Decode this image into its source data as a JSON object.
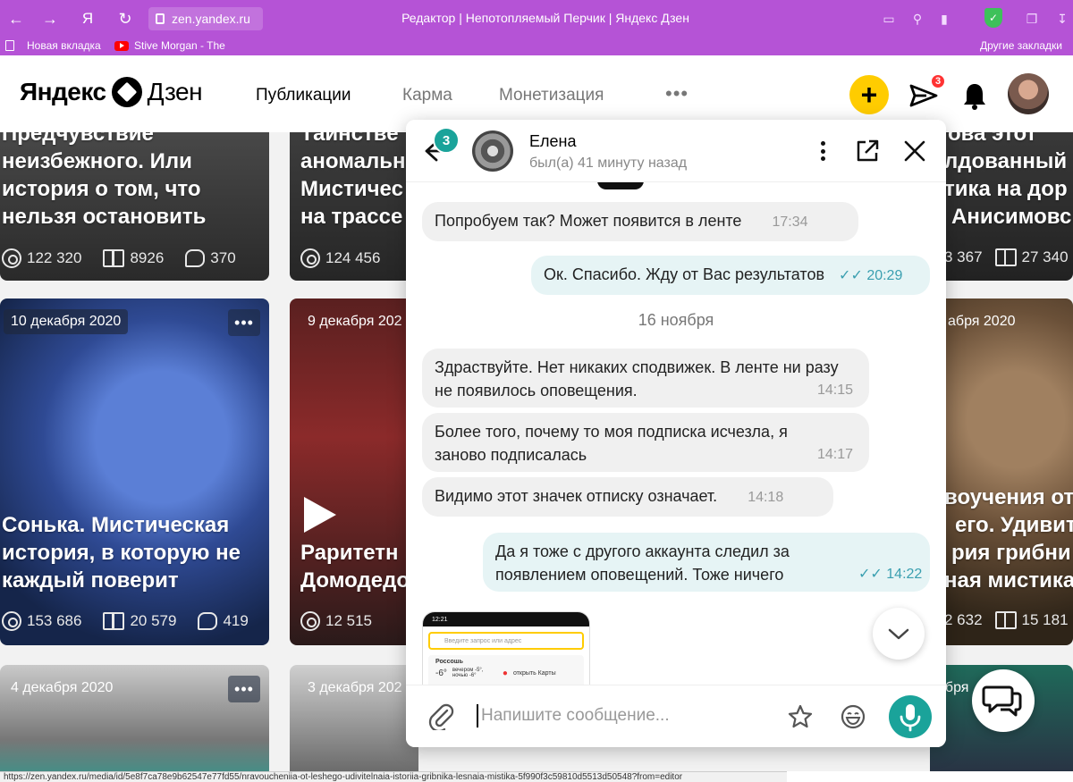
{
  "browser": {
    "url": "zen.yandex.ru",
    "tab_title": "Редактор | Непотопляемый Перчик | Яндекс Дзен",
    "nav_glyph_yandex": "Я",
    "bookmarks": [
      {
        "label": "Новая вкладка",
        "icon": "file-icon"
      },
      {
        "label": "Stive Morgan - The",
        "icon": "youtube-icon"
      }
    ],
    "other_bookmarks": "Другие закладки",
    "status_url": "https://zen.yandex.ru/media/id/5e8f7ca78e9b62547e77fd55/nravoucheniia-ot-leshego-udivitelnaia-istoriia-gribnika-lesnaia-mistika-5f990f3c59810d5513d50548?from=editor"
  },
  "header": {
    "logo_left": "Яндекс",
    "logo_right": "Дзен",
    "nav": [
      {
        "label": "Публикации",
        "active": true
      },
      {
        "label": "Карма",
        "active": false
      },
      {
        "label": "Монетизация",
        "active": false
      }
    ],
    "more": "•••",
    "plus": "+",
    "messages_badge": "3",
    "accent_color": "#ffcc00"
  },
  "feed": {
    "cards": [
      {
        "title_lines": [
          "Предчувствие",
          "неизбежного. Или",
          "история о том, что",
          "нельзя остановить"
        ],
        "views": "122 320",
        "reads": "8926",
        "comments": "370"
      },
      {
        "title_lines": [
          "Таинстве",
          "аномальн",
          "Мистичес",
          "на трассе"
        ],
        "views": "124 456"
      },
      {
        "title_lines": [
          "ова этот",
          "лдованный",
          "тика на дор",
          "Анисимовс"
        ],
        "views": "3 367",
        "reads": "27 340"
      },
      {
        "date": "10 декабря 2020",
        "dots": "•••",
        "title_lines": [
          "Сонька. Мистическая",
          "история, в которую не",
          "каждый поверит"
        ],
        "views": "153 686",
        "reads": "20 579",
        "comments": "419"
      },
      {
        "date": "9 декабря 202",
        "title_lines": [
          "Раритетн",
          "Домодедо"
        ],
        "views": "12 515"
      },
      {
        "date": "абря 2020",
        "title_lines": [
          "воучения от",
          "его. Удивит",
          "рия грибни",
          "ная мистика"
        ],
        "views": "2 632",
        "reads": "15 181"
      },
      {
        "date": "4 декабря 2020",
        "dots": "•••"
      },
      {
        "date": "3 декабря 202"
      },
      {
        "date": "абря"
      }
    ]
  },
  "chat": {
    "back_badge": "3",
    "contact_name": "Елена",
    "contact_status": "был(а) 41 минуту назад",
    "messages": [
      {
        "dir": "in",
        "text": "Попробуем так? Может появится в ленте",
        "time": "17:34"
      },
      {
        "dir": "out",
        "text": "Ок. Спасибо. Жду от Вас результатов",
        "time": "20:29"
      },
      {
        "dir": "sep",
        "text": "16 ноября"
      },
      {
        "dir": "in",
        "text": "Здраствуйте. Нет никаких сподвижек. В ленте ни разу не появилось оповещения.",
        "time": "14:15"
      },
      {
        "dir": "in",
        "text": "Более того, почему то моя подписка исчезла, я заново подписалась",
        "time": "14:17"
      },
      {
        "dir": "in",
        "text": "Видимо этот значек отписку означает.",
        "time": "14:18"
      },
      {
        "dir": "out",
        "text": "Да я тоже с другого аккаунта следил за появлением оповещений. Тоже ничего",
        "time": "14:22"
      }
    ],
    "attachment": {
      "status_time": "12:21",
      "search_placeholder": "Введите запрос или адрес",
      "card_title": "Россошь",
      "weather": "-6°",
      "weather_detail": "вечером -5°, ночью -6°",
      "maps_link": "открыть Карты"
    },
    "input_placeholder": "Напишите сообщение...",
    "accent_color": "#1aa39a"
  }
}
